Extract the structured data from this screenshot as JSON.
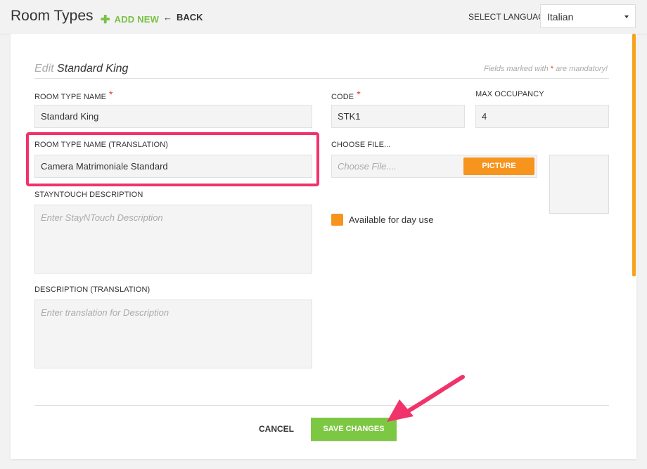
{
  "header": {
    "title": "Room Types",
    "add_new_label": "ADD NEW",
    "back_label": "BACK",
    "select_language_label": "SELECT LANGUAGE",
    "language_value": "Italian"
  },
  "form": {
    "edit_prefix": "Edit",
    "room_name": "Standard King",
    "mandatory_note_pre": "Fields marked with",
    "mandatory_star": "*",
    "mandatory_note_post": "are mandatory!",
    "room_type_name_label": "ROOM TYPE NAME",
    "room_type_name_value": "Standard King",
    "translation_label": "ROOM TYPE NAME (TRANSLATION)",
    "translation_value": "Camera Matrimoniale Standard",
    "stayntouch_desc_label": "STAYNTOUCH DESCRIPTION",
    "stayntouch_desc_placeholder": "Enter StayNTouch Description",
    "desc_translation_label": "DESCRIPTION (TRANSLATION)",
    "desc_translation_placeholder": "Enter translation for Description",
    "code_label": "CODE",
    "code_value": "STK1",
    "max_occupancy_label": "MAX OCCUPANCY",
    "max_occupancy_value": "4",
    "choose_file_label": "CHOOSE FILE...",
    "choose_file_placeholder": "Choose File....",
    "picture_button": "PICTURE",
    "day_use_label": "Available for day use",
    "day_use_checked": true
  },
  "actions": {
    "cancel_label": "CANCEL",
    "save_label": "SAVE CHANGES"
  },
  "colors": {
    "accent_green": "#7dc843",
    "accent_orange": "#f7941d",
    "highlight_pink": "#f0336b",
    "required_red": "#e53935"
  }
}
